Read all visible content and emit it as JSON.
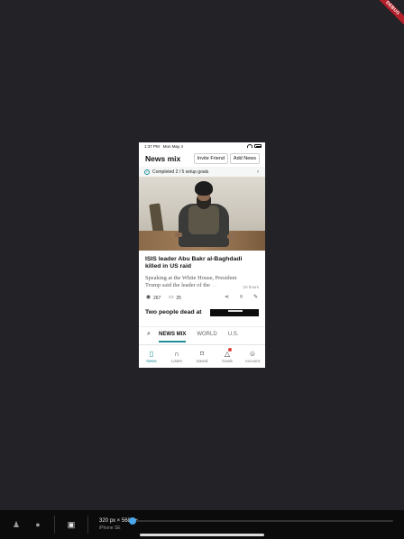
{
  "debug_banner": "DEBUG",
  "status_bar": {
    "time": "1:37 PM",
    "date": "Mon May 4"
  },
  "app_bar": {
    "title": "News mix",
    "invite_label": "Invite Friend",
    "add_news_label": "Add News"
  },
  "setup_banner": {
    "text": "Completed 2 / 5 setup goals",
    "completed": 2,
    "total": 5
  },
  "article": {
    "headline": "ISIS leader Abu Bakr al-Baghdadi killed in US raid",
    "summary_line1": "Speaking at the White House, President",
    "summary_line2": "Trump said the leader of the",
    "summary_fade": " …",
    "time": "10 hours",
    "views": "267",
    "comments": "25"
  },
  "next_article": {
    "headline": "Two people dead at"
  },
  "tabs": [
    {
      "label": "NEWS MIX",
      "active": true
    },
    {
      "label": "WORLD",
      "active": false
    },
    {
      "label": "U.S.",
      "active": false
    }
  ],
  "bottom_nav": [
    {
      "label": "News",
      "icon": "book-icon",
      "active": true
    },
    {
      "label": "Listen",
      "icon": "headphones-icon",
      "active": false
    },
    {
      "label": "Saved",
      "icon": "bookmark-icon",
      "active": false
    },
    {
      "label": "Goals",
      "icon": "bell-icon",
      "active": false
    },
    {
      "label": "Account",
      "icon": "person-icon",
      "active": false
    }
  ],
  "device_toolbar": {
    "size": "320 px × 568 px",
    "device": "iPhone SE",
    "zoom_fraction": 0
  },
  "colors": {
    "accent": "#1b8f94",
    "badge": "#e0413d",
    "background": "#232226",
    "slider": "#3aa0e8"
  }
}
